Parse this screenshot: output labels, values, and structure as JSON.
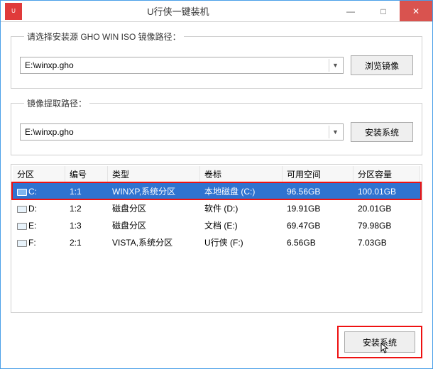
{
  "window": {
    "title": "U行侠一键装机",
    "minimize": "—",
    "maximize": "□",
    "close": "✕"
  },
  "group_source": {
    "legend": "请选择安装源 GHO WIN ISO 镜像路径：",
    "path": "E:\\winxp.gho",
    "browse_label": "浏览镜像"
  },
  "group_target": {
    "legend": "镜像提取路径：",
    "path": "E:\\winxp.gho",
    "install_label": "安装系统"
  },
  "table": {
    "headers": [
      "分区",
      "编号",
      "类型",
      "卷标",
      "可用空间",
      "分区容量"
    ],
    "rows": [
      {
        "part": "C:",
        "num": "1:1",
        "type": "WINXP,系统分区",
        "label": "本地磁盘 (C:)",
        "free": "96.56GB",
        "size": "100.01GB",
        "selected": true
      },
      {
        "part": "D:",
        "num": "1:2",
        "type": "磁盘分区",
        "label": "软件 (D:)",
        "free": "19.91GB",
        "size": "20.01GB",
        "selected": false
      },
      {
        "part": "E:",
        "num": "1:3",
        "type": "磁盘分区",
        "label": "文档 (E:)",
        "free": "69.47GB",
        "size": "79.98GB",
        "selected": false
      },
      {
        "part": "F:",
        "num": "2:1",
        "type": "VISTA,系统分区",
        "label": "U行侠 (F:)",
        "free": "6.56GB",
        "size": "7.03GB",
        "selected": false
      }
    ]
  },
  "footer": {
    "install_label": "安装系统"
  }
}
